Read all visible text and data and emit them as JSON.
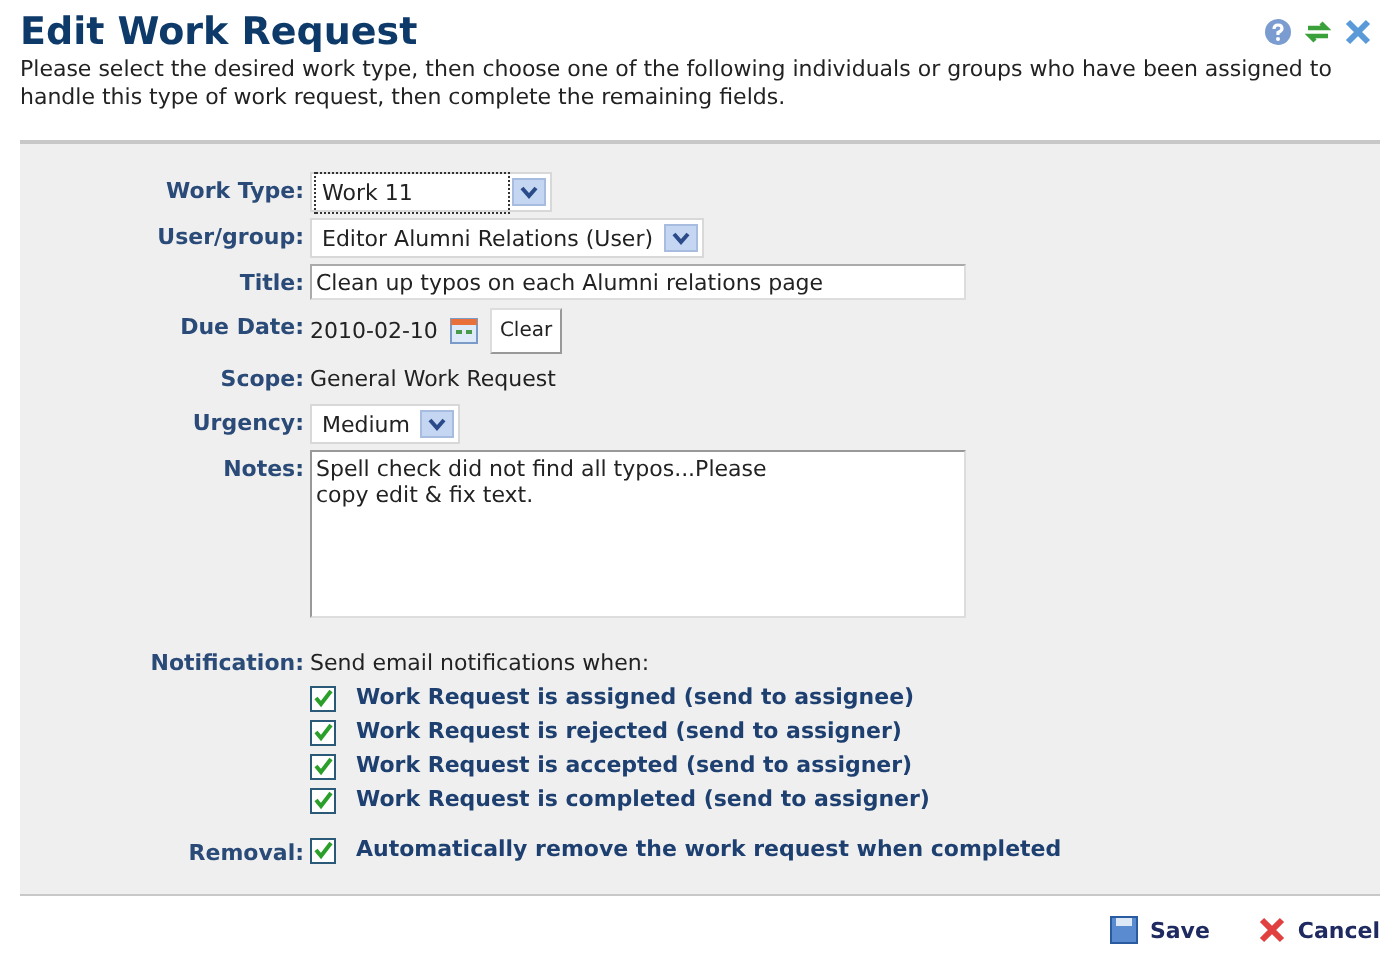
{
  "header": {
    "title": "Edit Work Request",
    "instructions": "Please select the desired work type, then choose one of the following individuals or groups who have been assigned to handle this type of work request, then complete the remaining fields."
  },
  "fields": [
    {
      "kind": "select",
      "label": "Work Type:",
      "value": "Work 11",
      "focused": true
    },
    {
      "kind": "select",
      "label": "User/group:",
      "value": "Editor Alumni Relations (User)",
      "focused": false
    },
    {
      "kind": "text",
      "label": "Title:",
      "value": "Clean up typos on each Alumni relations page"
    },
    {
      "kind": "date",
      "label": "Due Date:",
      "value": "2010-02-10",
      "button": "Clear"
    },
    {
      "kind": "static",
      "label": "Scope:",
      "value": "General Work Request"
    },
    {
      "kind": "select",
      "label": "Urgency:",
      "value": "Medium",
      "focused": false
    },
    {
      "kind": "textarea",
      "label": "Notes:",
      "value": "Spell check did not find all typos...Please\ncopy edit & fix text."
    }
  ],
  "notification": {
    "label": "Notification:",
    "intro": "Send email notifications when:",
    "options": [
      {
        "label": "Work Request is assigned (send to assignee)",
        "checked": true
      },
      {
        "label": "Work Request is rejected (send to assigner)",
        "checked": true
      },
      {
        "label": "Work Request is accepted (send to assigner)",
        "checked": true
      },
      {
        "label": "Work Request is completed (send to assigner)",
        "checked": true
      }
    ]
  },
  "removal": {
    "label": "Removal:",
    "option": {
      "label": "Automatically remove the work request when completed",
      "checked": true
    }
  },
  "buttons": [
    {
      "kind": "save",
      "label": "Save"
    },
    {
      "kind": "cancel",
      "label": "Cancel"
    }
  ]
}
